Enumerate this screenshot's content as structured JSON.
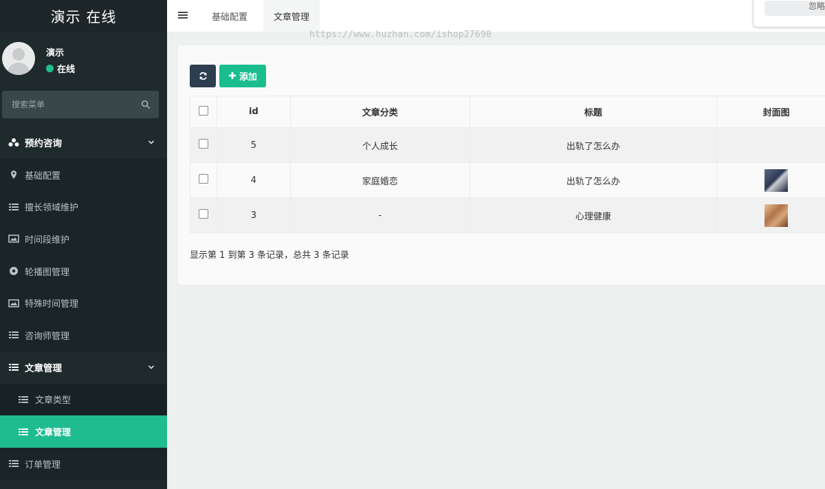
{
  "brand": {
    "title": "演示 在线"
  },
  "user": {
    "name": "演示",
    "status": "在线"
  },
  "search": {
    "placeholder": "搜索菜单"
  },
  "menu": {
    "items": [
      {
        "label": "预约咨询",
        "icon": "sitemap-icon",
        "type": "header"
      },
      {
        "label": "基础配置",
        "icon": "map-marker-icon",
        "type": "level1"
      },
      {
        "label": "擅长领域维护",
        "icon": "list-icon",
        "type": "level1"
      },
      {
        "label": "时间段维护",
        "icon": "image-icon",
        "type": "level1"
      },
      {
        "label": "轮播图管理",
        "icon": "dot-circle-icon",
        "type": "level1"
      },
      {
        "label": "特殊时间管理",
        "icon": "image-icon",
        "type": "level1"
      },
      {
        "label": "咨询师管理",
        "icon": "list-icon",
        "type": "level1"
      },
      {
        "label": "文章管理",
        "icon": "list-icon",
        "type": "header"
      },
      {
        "label": "文章类型",
        "icon": "list-icon",
        "type": "sub"
      },
      {
        "label": "文章管理",
        "icon": "list-icon",
        "type": "sub-active"
      },
      {
        "label": "订单管理",
        "icon": "list-icon",
        "type": "plain"
      }
    ]
  },
  "topbar": {
    "tabs": [
      {
        "label": "基础配置"
      },
      {
        "label": "文章管理"
      }
    ],
    "corner_text": "忽略"
  },
  "watermark": "https://www.huzhan.com/ishop27690",
  "toolbar": {
    "add_label": "添加"
  },
  "table": {
    "columns": [
      "id",
      "文章分类",
      "标题",
      "封面图"
    ],
    "rows": [
      {
        "id": "5",
        "category": "个人成长",
        "title": "出轨了怎么办",
        "cover": ""
      },
      {
        "id": "4",
        "category": "家庭婚恋",
        "title": "出轨了怎么办",
        "cover": "photo-thumbnail"
      },
      {
        "id": "3",
        "category": "-",
        "title": "心理健康",
        "cover": "photo-thumbnail"
      }
    ]
  },
  "pagination": {
    "info": "显示第 1 到第 3 条记录，总共 3 条记录"
  },
  "colors": {
    "sidebar_bg": "#1f2a2c",
    "accent": "#1fbc8f",
    "refresh_button": "#2c3e50",
    "status_online": "#21c18f"
  }
}
